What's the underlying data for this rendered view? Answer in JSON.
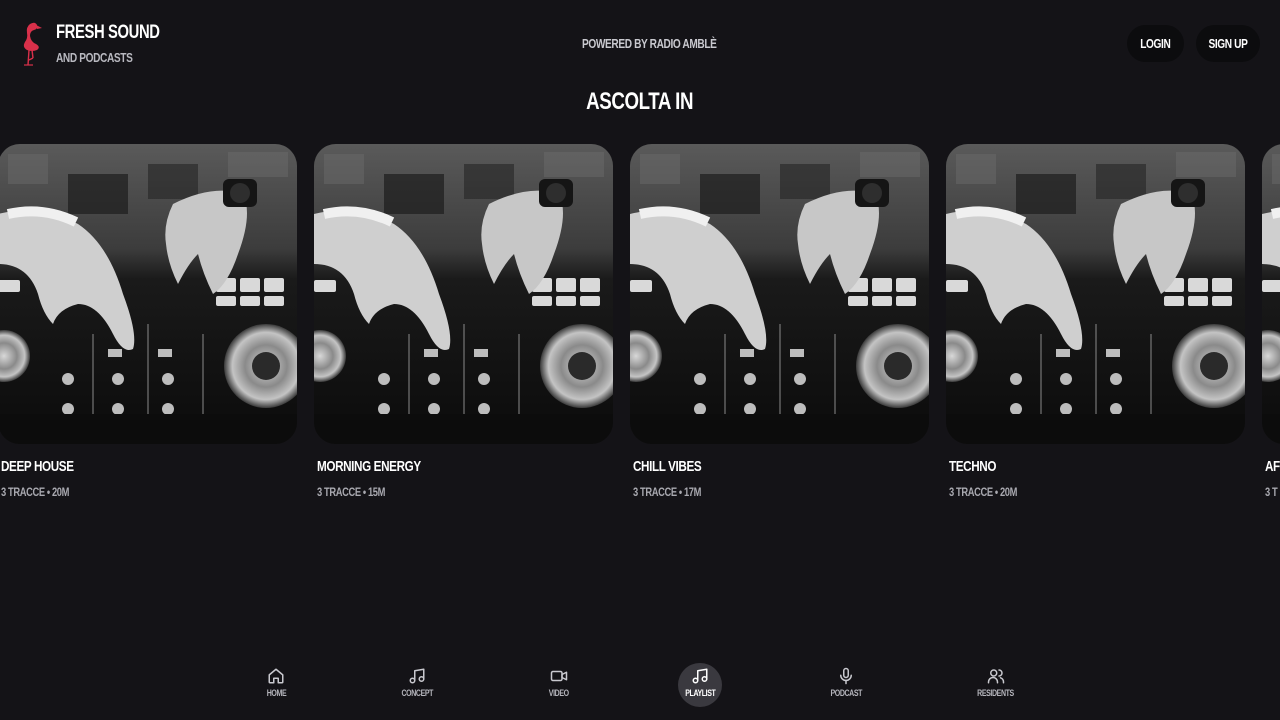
{
  "brand": {
    "title": "FRESH SOUND",
    "subtitle": "AND PODCASTS",
    "accent_color": "#d9304a",
    "logo_icon": "flamingo-icon"
  },
  "header": {
    "powered_by": "POWERED BY RADIO AMBLÈ",
    "login_label": "LOGIN",
    "signup_label": "SIGN UP"
  },
  "section": {
    "title": "ASCOLTA IN"
  },
  "playlists": [
    {
      "title": "DEEP HOUSE",
      "meta": "3 TRACCE • 20M"
    },
    {
      "title": "MORNING ENERGY",
      "meta": "3 TRACCE • 15M"
    },
    {
      "title": "CHILL VIBES",
      "meta": "3 TRACCE • 17M"
    },
    {
      "title": "TECHNO",
      "meta": "3 TRACCE • 20M"
    },
    {
      "title": "AF",
      "meta": "3 T"
    }
  ],
  "nav": {
    "items": [
      {
        "label": "HOME",
        "icon": "home-icon"
      },
      {
        "label": "CONCEPT",
        "icon": "music-note-icon"
      },
      {
        "label": "VIDEO",
        "icon": "video-camera-icon"
      },
      {
        "label": "PLAYLIST",
        "icon": "music-note-icon",
        "active": true
      },
      {
        "label": "PODCAST",
        "icon": "microphone-icon"
      },
      {
        "label": "RESIDENTS",
        "icon": "users-icon"
      }
    ]
  }
}
